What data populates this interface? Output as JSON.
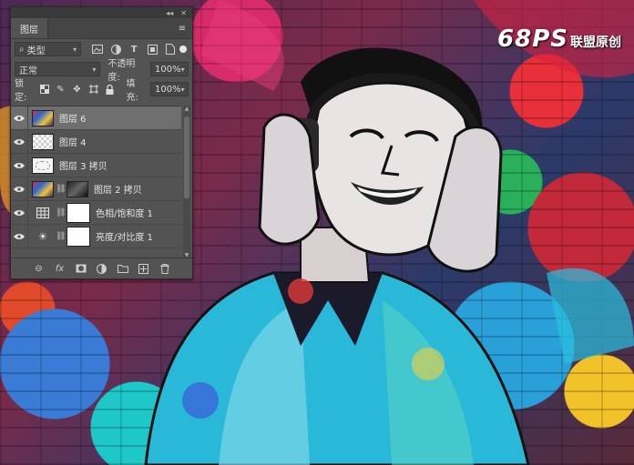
{
  "watermark": {
    "logo": "68PS",
    "text": "联盟原创"
  },
  "panel": {
    "collapse_glyph": "◂◂",
    "close_glyph": "✕",
    "tab_label": "图层",
    "menu_icon": "≡",
    "filter": {
      "kind_label": "类型",
      "search_icon": "⌕"
    },
    "filter_icons": [
      "image-filter-icon",
      "adjustment-filter-icon",
      "text-filter-icon",
      "shape-filter-icon",
      "smart-object-filter-icon"
    ],
    "blend_mode": "正常",
    "opacity_label": "不透明度:",
    "opacity_value": "100%",
    "lock_label": "锁定:",
    "fill_label": "填充:",
    "fill_value": "100%",
    "layers": [
      {
        "name": "图层 6",
        "thumb": "photo",
        "selected": true
      },
      {
        "name": "图层 4",
        "thumb": "checker",
        "selected": false
      },
      {
        "name": "图层 3 拷贝",
        "thumb": "sketch",
        "selected": false
      },
      {
        "name": "图层 2 拷贝",
        "thumb": "masked-photo",
        "selected": false
      },
      {
        "name": "色相/饱和度 1",
        "thumb": "hue-saturation-adjustment",
        "selected": false
      },
      {
        "name": "亮度/对比度 1",
        "thumb": "brightness-contrast-adjustment",
        "selected": false
      }
    ],
    "bottom_icons": [
      "link-icon",
      "fx-icon",
      "add-mask-icon",
      "new-adjustment-icon",
      "new-group-icon",
      "new-layer-icon",
      "trash-icon"
    ],
    "fx_label": "fx"
  }
}
